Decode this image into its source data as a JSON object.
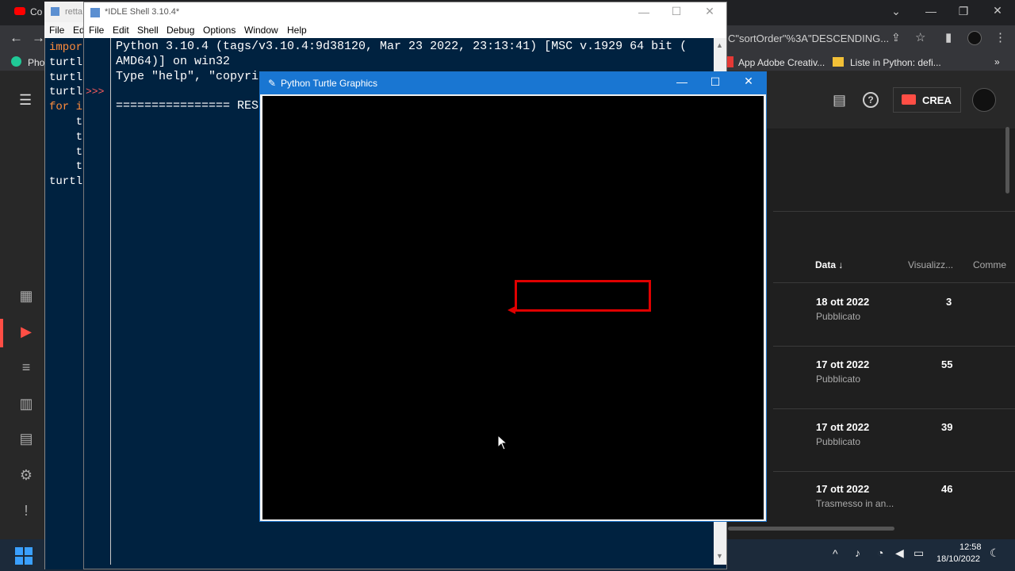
{
  "browser": {
    "tab1_label": "Co",
    "address_text": "C\"sortOrder\"%3A\"DESCENDING...",
    "bookmarks": [
      "Pho",
      "App Adobe Creativ...",
      "Liste in Python: defi..."
    ]
  },
  "youtube": {
    "create_label": "CREA",
    "columns": {
      "date": "Data ↓",
      "views": "Visualizz...",
      "comments": "Comme"
    },
    "rows": [
      {
        "date": "18 ott 2022",
        "status": "Pubblicato",
        "views": "3"
      },
      {
        "date": "17 ott 2022",
        "status": "Pubblicato",
        "views": "55"
      },
      {
        "date": "17 ott 2022",
        "status": "Pubblicato",
        "views": "39"
      },
      {
        "date": "17 ott 2022",
        "status": "Trasmesso in an...",
        "views": "46"
      }
    ]
  },
  "editor": {
    "title": "retta",
    "menu": [
      "File",
      "Ed"
    ],
    "code_lines": [
      "impor",
      "turtl",
      "turtl",
      "turtl",
      "for i",
      "    t",
      "    t",
      "    t",
      "    t",
      "turtl"
    ]
  },
  "idle": {
    "title": "*IDLE Shell 3.10.4*",
    "menu": [
      "File",
      "Edit",
      "Shell",
      "Debug",
      "Options",
      "Window",
      "Help"
    ],
    "lines": [
      "Python 3.10.4 (tags/v3.10.4:9d38120, Mar 23 2022, 23:13:41) [MSC v.1929 64 bit (",
      "AMD64)] on win32",
      "Type \"help\", \"copyri",
      "",
      "================ RES"
    ],
    "prompt": ">>>"
  },
  "turtle": {
    "title": "Python Turtle Graphics"
  },
  "taskbar": {
    "time": "12:58",
    "date": "18/10/2022"
  }
}
